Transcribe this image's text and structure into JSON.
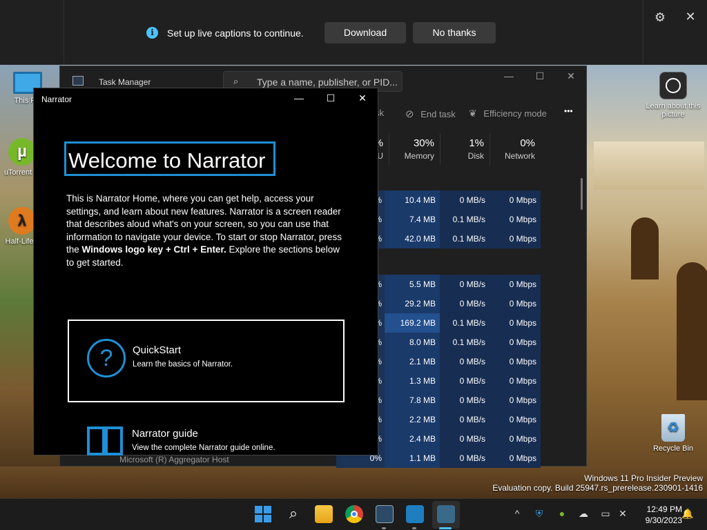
{
  "caption_bar": {
    "message": "Set up live captions to continue.",
    "download_label": "Download",
    "no_thanks_label": "No thanks"
  },
  "desktop": {
    "icons": [
      {
        "label": "This PC"
      },
      {
        "label": "uTorrent"
      },
      {
        "label": "Half-Life"
      },
      {
        "label": "Learn about this picture"
      },
      {
        "label": "Recycle Bin"
      }
    ],
    "watermark_line1": "Windows 11 Pro Insider Preview",
    "watermark_line2": "Evaluation copy. Build 25947.rs_prerelease.230901-1416"
  },
  "task_manager": {
    "title": "Task Manager",
    "search_placeholder": "Type a name, publisher, or PID...",
    "toolbar": {
      "run_task_tail": "sk",
      "end_task": "End task",
      "efficiency_mode": "Efficiency mode",
      "more": "•••"
    },
    "columns": [
      {
        "pct": "%",
        "label": "U"
      },
      {
        "pct": "30%",
        "label": "Memory"
      },
      {
        "pct": "1%",
        "label": "Disk"
      },
      {
        "pct": "0%",
        "label": "Network"
      }
    ],
    "rows": [
      {
        "cpu": "%",
        "memory": "10.4 MB",
        "disk": "0 MB/s",
        "network": "0 Mbps"
      },
      {
        "cpu": "%",
        "memory": "7.4 MB",
        "disk": "0.1 MB/s",
        "network": "0 Mbps"
      },
      {
        "cpu": "%",
        "memory": "42.0 MB",
        "disk": "0.1 MB/s",
        "network": "0 Mbps"
      },
      {
        "cpu": "%",
        "memory": "5.5 MB",
        "disk": "0 MB/s",
        "network": "0 Mbps"
      },
      {
        "cpu": "%",
        "memory": "29.2 MB",
        "disk": "0 MB/s",
        "network": "0 Mbps"
      },
      {
        "cpu": "%",
        "memory": "169.2 MB",
        "disk": "0.1 MB/s",
        "network": "0 Mbps"
      },
      {
        "cpu": "%",
        "memory": "8.0 MB",
        "disk": "0.1 MB/s",
        "network": "0 Mbps"
      },
      {
        "cpu": "%",
        "memory": "2.1 MB",
        "disk": "0 MB/s",
        "network": "0 Mbps"
      },
      {
        "cpu": "%",
        "memory": "1.3 MB",
        "disk": "0 MB/s",
        "network": "0 Mbps"
      },
      {
        "cpu": "%",
        "memory": "7.8 MB",
        "disk": "0 MB/s",
        "network": "0 Mbps"
      },
      {
        "cpu": "%",
        "memory": "2.2 MB",
        "disk": "0 MB/s",
        "network": "0 Mbps"
      },
      {
        "cpu": "%",
        "memory": "2.4 MB",
        "disk": "0 MB/s",
        "network": "0 Mbps"
      },
      {
        "cpu": "0%",
        "memory": "1.1 MB",
        "disk": "0 MB/s",
        "network": "0 Mbps"
      }
    ],
    "aggregator_label": "Microsoft (R) Aggregator Host"
  },
  "narrator": {
    "title": "Narrator",
    "heading": "Welcome to Narrator",
    "body_part1": "This is Narrator Home, where you can get help, access your settings, and learn about new features. Narrator is a screen reader that describes aloud what's on your screen, so you can use that information to navigate your device. To start or stop Narrator, press the ",
    "body_bold": "Windows logo key + Ctrl + Enter.",
    "body_part2": " Explore the sections below to get started.",
    "quickstart_title": "QuickStart",
    "quickstart_sub": "Learn the basics of Narrator.",
    "guide_title": "Narrator guide",
    "guide_sub": "View the complete Narrator guide online."
  },
  "taskbar": {
    "time": "12:49 PM",
    "date": "9/30/2023",
    "apps": [
      {
        "icon": "windows-start-icon"
      },
      {
        "icon": "search-icon"
      },
      {
        "icon": "file-explorer-icon"
      },
      {
        "icon": "chrome-icon"
      },
      {
        "icon": "task-manager-icon"
      },
      {
        "icon": "terminal-icon"
      },
      {
        "icon": "narrator-icon"
      }
    ]
  },
  "colors": {
    "accent_blue": "#1e90d6",
    "info_blue": "#4cc2ff"
  }
}
